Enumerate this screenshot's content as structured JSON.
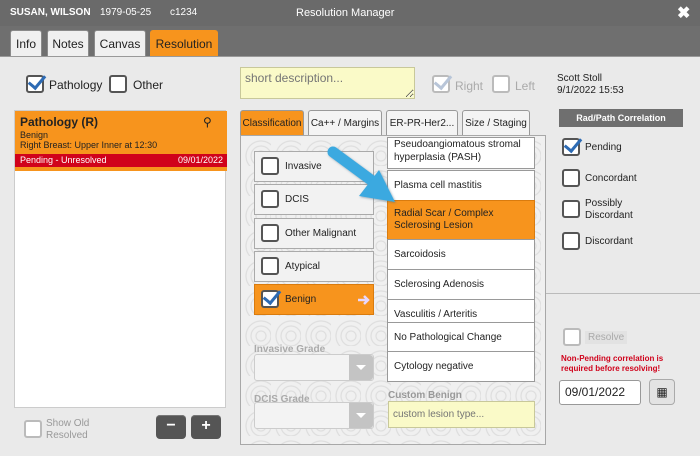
{
  "titlebar": {
    "patient": "SUSAN, WILSON",
    "dob": "1979-05-25",
    "id": "c1234",
    "title": "Resolution Manager",
    "close": "✖"
  },
  "tabs": [
    "Info",
    "Notes",
    "Canvas",
    "Resolution"
  ],
  "filters": {
    "pathology": "Pathology",
    "other": "Other"
  },
  "card": {
    "title": "Pathology (R)",
    "link_icon": "⚲",
    "subtitle": "Benign",
    "location": "Right Breast: Upper Inner at 12:30",
    "status": "Pending - Unresolved",
    "date": "09/01/2022"
  },
  "show_old": "Show Old Resolved",
  "minus": "−",
  "plus": "+",
  "description": {
    "placeholder": "short description..."
  },
  "side": {
    "right": "Right",
    "left": "Left"
  },
  "author": {
    "name": "Scott Stoll",
    "datetime": "9/1/2022 15:53"
  },
  "subtabs": [
    "Classification",
    "Ca++ / Margins",
    "ER-PR-Her2...",
    "Size / Staging"
  ],
  "classification": [
    {
      "label": "Invasive",
      "checked": false
    },
    {
      "label": "DCIS",
      "checked": false
    },
    {
      "label": "Other Malignant",
      "checked": false
    },
    {
      "label": "Atypical",
      "checked": false
    },
    {
      "label": "Benign",
      "checked": true
    }
  ],
  "benign_options": [
    "Pseudoangiomatous stromal hyperplasia (PASH)",
    "Plasma cell mastitis",
    "Radial Scar / Complex Sclerosing Lesion",
    "Sarcoidosis",
    "Sclerosing Adenosis",
    "Vasculitis / Arteritis",
    "No Pathological Change",
    "Cytology negative"
  ],
  "invasive_grade": "Invasive Grade",
  "dcis_grade": "DCIS Grade",
  "custom_benign": {
    "label": "Custom Benign",
    "placeholder": "custom lesion type..."
  },
  "rad_path": {
    "header": "Rad/Path Correlation",
    "options": [
      "Pending",
      "Concordant",
      "Possibly Discordant",
      "Discordant"
    ]
  },
  "resolve": "Resolve",
  "warning": "Non-Pending correlation is required before resolving!",
  "resolve_date": "09/01/2022",
  "calendar_icon": "▦",
  "colors": {
    "accent": "#f7941d",
    "status_red": "#d0021b",
    "arrow": "#3aa9e0"
  }
}
